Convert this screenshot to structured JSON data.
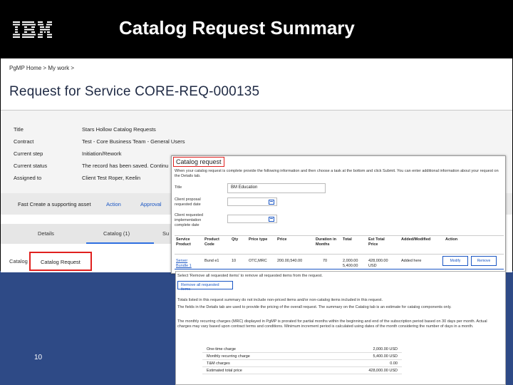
{
  "slide": {
    "logo": "IBM",
    "title": "Catalog Request Summary",
    "page_number": "10"
  },
  "breadcrumb": "PgMP Home  >  My work  >",
  "page_heading": "Request for Service CORE-REQ-000135",
  "info": [
    {
      "key": "Title",
      "value": "Stars Hollow Catalog Requests"
    },
    {
      "key": "Contract",
      "value": "Test - Core Business Team - General Users"
    },
    {
      "key": "Current step",
      "value": "Initiation/Rework"
    },
    {
      "key": "Current status",
      "value": "The record has been saved. Continu"
    },
    {
      "key": "Assigned to",
      "value": "Client Test Roper, Keelin"
    }
  ],
  "action_bar": {
    "fast_create": "Fast Create a supporting asset",
    "action": "Action",
    "approval": "Approval"
  },
  "tabs": [
    "Details",
    "Catalog (1)",
    "Su"
  ],
  "catalog_section": {
    "label": "Catalog",
    "selected": "Catalog Request"
  },
  "dialog": {
    "title": "Catalog request",
    "intro": "When your catalog request is complete provide the following information and then choose a task at the bottom and click Submit. You can enter additional information about your request on the Details tab.",
    "title_label": "Title",
    "title_value": "BM Education",
    "date1_label": "Client proposal requested date",
    "date2_label": "Client requested implementation complete date",
    "columns": [
      "Service Product",
      "Product Code",
      "Qty",
      "Price type",
      "Price",
      "Duration in Months",
      "Total",
      "Est Total Price",
      "Added/Modified",
      "Action"
    ],
    "row": {
      "service_product": "Server Bundle 1",
      "product_code": "Bund e1",
      "qty": "10",
      "price_type": "OTC,MRC",
      "price": "200.00,540.00",
      "duration": "70",
      "total": "2,000.00 5,400.00",
      "est_total": "428,000.00 USD",
      "added": "Added here",
      "btn1": "Modify",
      "btn2": "Remove"
    }
  },
  "note_panel": {
    "select_text": "Select 'Remove all requested items' to remove all requested items from the request.",
    "remove_button": "Remove all requested items",
    "note1": "Totals listed in this request summary do not include non-priced items and/or non-catalog items included in this request.",
    "note2": "The fields in the Details tab are used to provide the pricing of the overall request. The summary on the Catalog tab is an estimate for catalog components only.",
    "note3": "The monthly recurring charges (MRC) displayed in PgMP is prorated for partial months within the beginning and end of the subscription period based on 30 days per month. Actual charges may vary based upon contract terms and conditions. Minimum increment period is calculated using dates of the month considering the number of days in a month.",
    "totals": [
      {
        "label": "One-time charge",
        "value": "2,000.00 USD"
      },
      {
        "label": "Monthly recurring charge",
        "value": "5,400.00 USD"
      },
      {
        "label": "T&M charges",
        "value": "0.00"
      },
      {
        "label": "Estimated total price",
        "value": "428,000.00 USD"
      }
    ]
  }
}
